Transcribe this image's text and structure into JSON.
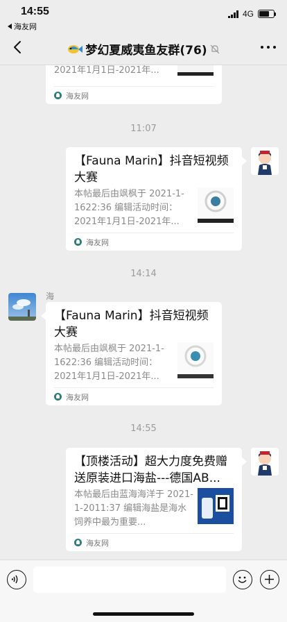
{
  "status_bar": {
    "time": "14:55",
    "back_app": "海友网",
    "network": "4G"
  },
  "header": {
    "title": "梦幻夏威夷鱼友群(76)",
    "icons": [
      "back-chevron-icon",
      "fish-emoji-icon",
      "mute-bell-icon",
      "more-dots-icon"
    ]
  },
  "messages": [
    {
      "type": "link-card",
      "direction": "outgoing-partial",
      "desc_tail": "2021年1月1日-2021年...",
      "source": "海友网"
    },
    {
      "type": "timestamp",
      "text": "11:07"
    },
    {
      "type": "link-card",
      "direction": "outgoing",
      "title": "【Fauna Marin】抖音短视频大赛",
      "desc": "本帖最后由飒枫于 2021-1-1622:36 编辑活动时间：2021年1月1日-2021年...",
      "source": "海友网"
    },
    {
      "type": "timestamp",
      "text": "14:14"
    },
    {
      "type": "link-card",
      "direction": "incoming",
      "sender": "海",
      "title": "【Fauna Marin】抖音短视频大赛",
      "desc": "本帖最后由飒枫于 2021-1-1622:36 编辑活动时间：2021年1月1日-2021年...",
      "source": "海友网"
    },
    {
      "type": "timestamp",
      "text": "14:55"
    },
    {
      "type": "link-card",
      "direction": "outgoing",
      "title": "【顶楼活动】超大力度免费赠送原装进口海盐---德国AB...",
      "desc": "本帖最后由蓝海海洋于 2021-1-2011:37 编辑海盐是海水饲养中最为重要...",
      "source": "海友网"
    }
  ],
  "input_bar": {
    "icons": [
      "voice-icon",
      "emoji-icon",
      "plus-icon"
    ]
  },
  "colors": {
    "chat_bg": "#ededed",
    "card_bg": "#ffffff",
    "timestamp": "#9b9b9b",
    "desc_text": "#8a8a8a"
  }
}
